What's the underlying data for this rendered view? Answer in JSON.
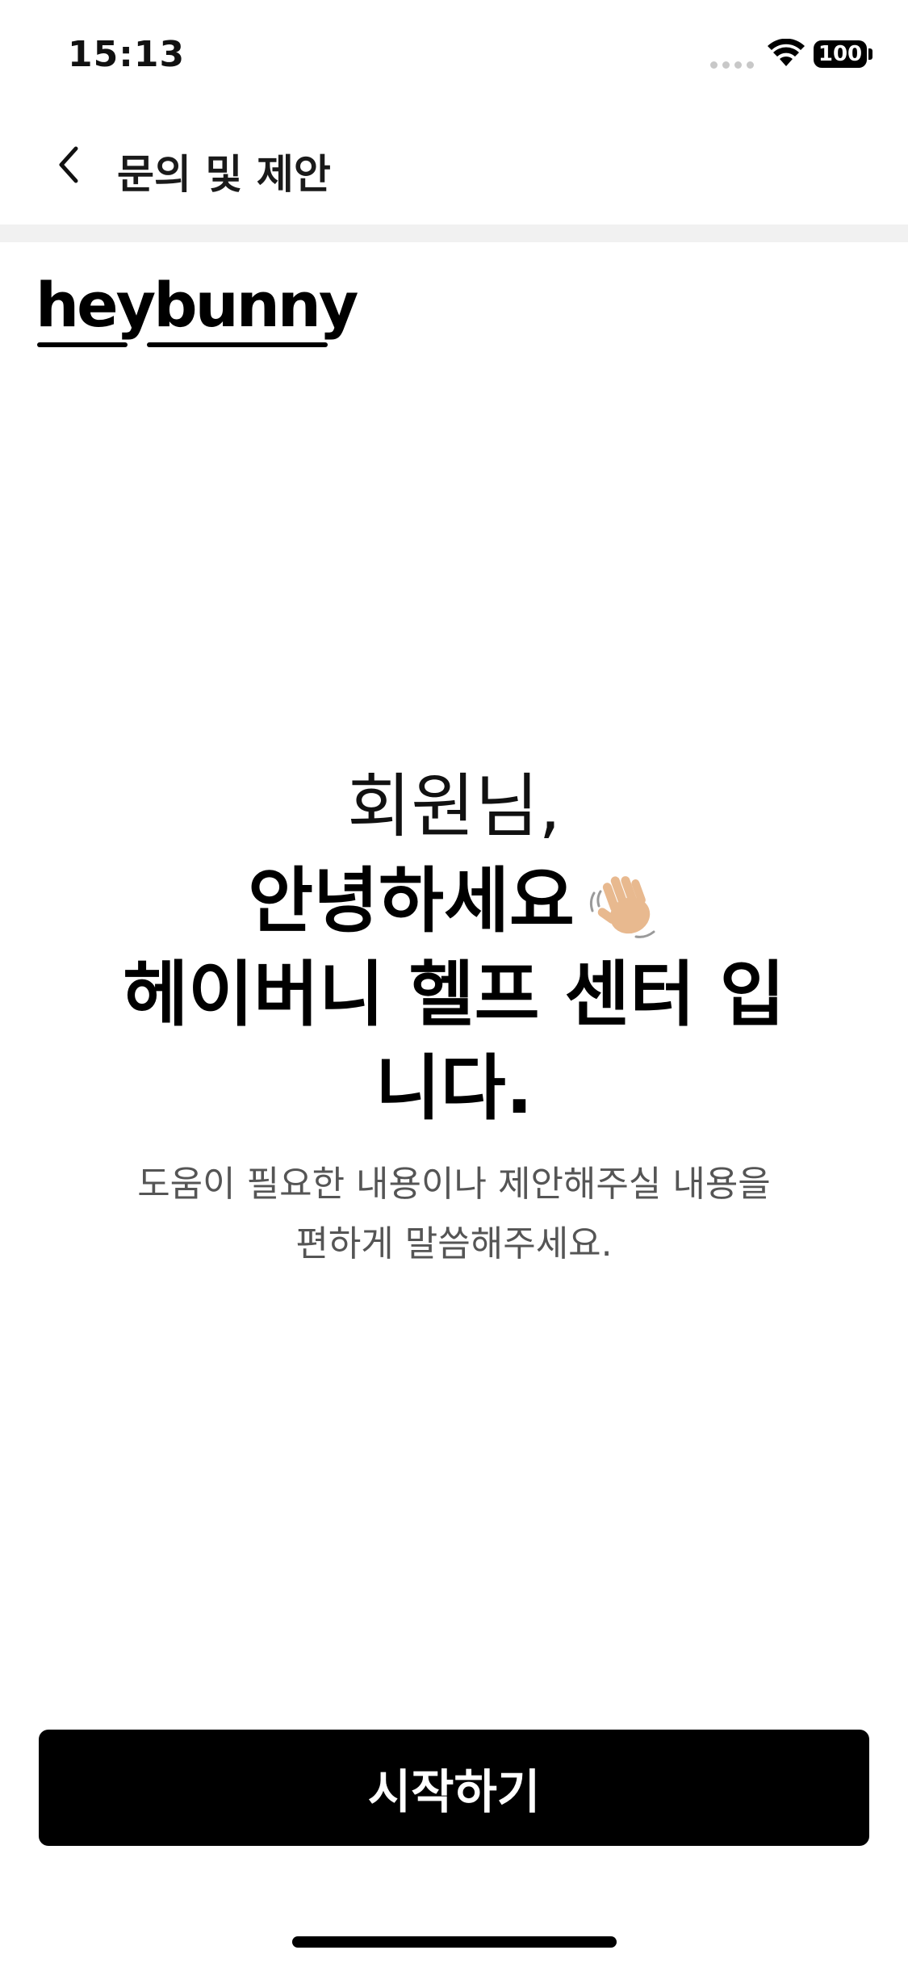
{
  "status_bar": {
    "time": "15:13",
    "battery": "100",
    "icons": [
      "signal-dots-icon",
      "wifi-icon",
      "battery-icon"
    ]
  },
  "nav": {
    "back_icon": "chevron-left-icon",
    "title": "문의 및 제안"
  },
  "brand": {
    "logo_text": "heybunny"
  },
  "greeting": {
    "line1": "회원님,",
    "line2": "안녕하세요",
    "line3": "헤이버니 헬프 센터 입니다.",
    "emoji": "waving-hand-icon"
  },
  "subtext": {
    "line1": "도움이 필요한 내용이나 제안해주실 내용을",
    "line2": "편하게 말씀해주세요."
  },
  "cta": {
    "label": "시작하기"
  },
  "colors": {
    "primary": "#000000",
    "background": "#ffffff",
    "divider": "#f1f1f1",
    "subtext": "#555555"
  }
}
